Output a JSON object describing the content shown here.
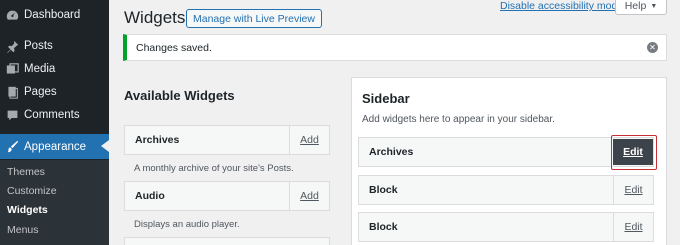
{
  "admin_menu": {
    "items": [
      {
        "label": "Dashboard",
        "icon": "dashboard-icon"
      },
      {
        "label": "Posts",
        "icon": "pin-icon"
      },
      {
        "label": "Media",
        "icon": "media-icon"
      },
      {
        "label": "Pages",
        "icon": "page-icon"
      },
      {
        "label": "Comments",
        "icon": "comment-icon"
      },
      {
        "label": "Appearance",
        "icon": "paintbrush-icon"
      }
    ],
    "submenu": [
      "Themes",
      "Customize",
      "Widgets",
      "Menus"
    ]
  },
  "header": {
    "title": "Widgets",
    "live_preview_label": "Manage with Live Preview",
    "accessibility_link": "Disable accessibility mode",
    "help_label": "Help"
  },
  "notice": {
    "text": "Changes saved."
  },
  "available": {
    "title": "Available Widgets",
    "add_label": "Add",
    "widgets": [
      {
        "title": "Archives",
        "description": "A monthly archive of your site's Posts."
      },
      {
        "title": "Audio",
        "description": "Displays an audio player."
      }
    ]
  },
  "sidebar": {
    "title": "Sidebar",
    "description": "Add widgets here to appear in your sidebar.",
    "edit_label": "Edit",
    "widgets": [
      {
        "title": "Archives"
      },
      {
        "title": "Block"
      },
      {
        "title": "Block"
      }
    ]
  },
  "colors": {
    "admin_bg": "#1d2327",
    "accent": "#2271b1",
    "notice_success": "#00a32a",
    "highlight": "#c92c35"
  }
}
